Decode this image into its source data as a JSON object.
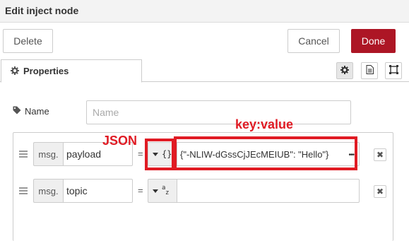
{
  "dialog": {
    "title": "Edit inject node",
    "delete_label": "Delete",
    "cancel_label": "Cancel",
    "done_label": "Done"
  },
  "tabs": {
    "properties_label": "Properties"
  },
  "name_field": {
    "label": "Name",
    "placeholder": "Name",
    "value": ""
  },
  "props": [
    {
      "prefix": "msg.",
      "property": "payload",
      "equals": "=",
      "type_glyph": "{}",
      "value": "{\"-NLIW-dGssCjJEcMEIUB\": \"Hello\"}"
    },
    {
      "prefix": "msg.",
      "property": "topic",
      "equals": "=",
      "type_glyph": "az",
      "value": ""
    }
  ],
  "annotations": {
    "json_label": "JSON",
    "kv_label": "key:value",
    "color": "#e01b24"
  },
  "colors": {
    "done_button": "#ad1625"
  },
  "icons": {
    "tab": "gear-icon",
    "name": "tag-icon",
    "tab_buttons": [
      "gear-icon",
      "document-icon",
      "appearance-icon"
    ],
    "row_handle": "drag-handle-icon",
    "row_remove": "close-icon"
  }
}
